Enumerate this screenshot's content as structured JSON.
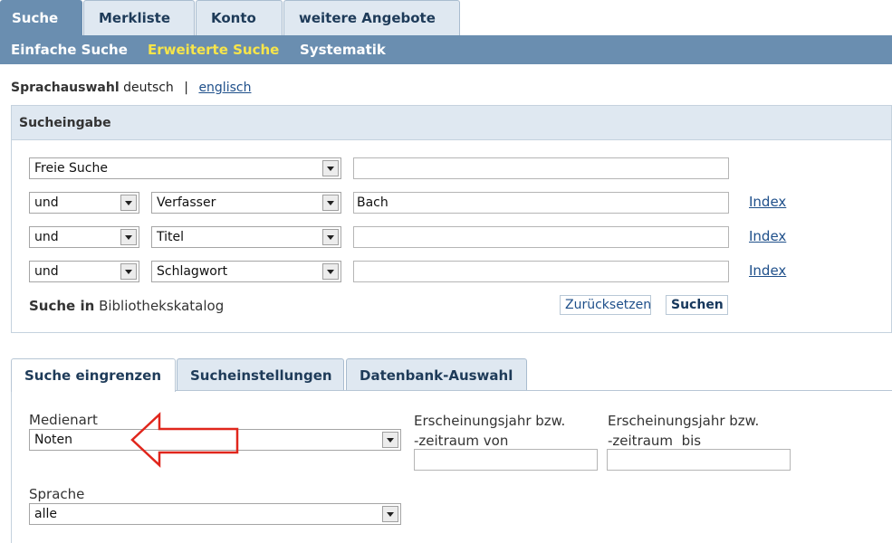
{
  "top_tabs": [
    "Suche",
    "Merkliste",
    "Konto",
    "weitere Angebote"
  ],
  "nav": {
    "items": [
      "Einfache Suche",
      "Erweiterte Suche",
      "Systematik"
    ],
    "active": "Erweiterte Suche"
  },
  "language": {
    "label": "Sprachauswahl",
    "current": "deutsch",
    "separator": "|",
    "other": "englisch"
  },
  "search_panel": {
    "title": "Sucheingabe",
    "rows": [
      {
        "field": "Freie Suche",
        "value": ""
      },
      {
        "operator": "und",
        "field": "Verfasser",
        "value": "Bach",
        "index": "Index"
      },
      {
        "operator": "und",
        "field": "Titel",
        "value": "",
        "index": "Index"
      },
      {
        "operator": "und",
        "field": "Schlagwort",
        "value": "",
        "index": "Index"
      }
    ],
    "search_in_label": "Suche in",
    "search_in_value": "Bibliothekskatalog",
    "reset_label": "Zurücksetzen",
    "search_label": "Suchen"
  },
  "filter_tabs": [
    "Suche eingrenzen",
    "Sucheinstellungen",
    "Datenbank-Auswahl"
  ],
  "filters": {
    "media_label": "Medienart",
    "media_value": "Noten",
    "year_from_label_1": "Erscheinungsjahr bzw.",
    "year_from_label_2": "-zeitraum von",
    "year_to_label_1": "Erscheinungsjahr bzw.",
    "year_to_label_2": "-zeitraum  bis",
    "year_from_value": "",
    "year_to_value": "",
    "language_label": "Sprache",
    "language_value": "alle"
  },
  "colors": {
    "nav_blue": "#6a8eb0",
    "active_nav": "#f7e54a",
    "annotation_arrow": "#e0261c"
  }
}
